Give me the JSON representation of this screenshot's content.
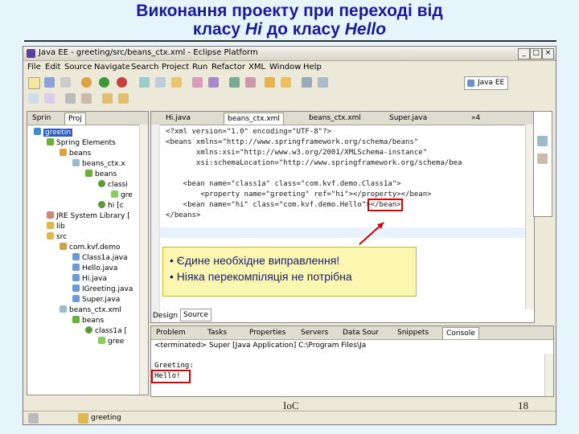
{
  "slide": {
    "title_line1": "Виконання проекту при переході від",
    "title_line2_a": "класу ",
    "title_line2_hi": "Hi",
    "title_line2_b": " до класу ",
    "title_line2_hello": "Hello",
    "footer_center": "IoC",
    "page_number": "18"
  },
  "window": {
    "title": "Java EE - greeting/src/beans_ctx.xml - Eclipse Platform",
    "minimize": "_",
    "maximize": "□",
    "close": "×"
  },
  "menu": [
    "File",
    "Edit",
    "Source",
    "Navigate",
    "Search",
    "Project",
    "Run",
    "Refactor",
    "XML",
    "Window",
    "Help"
  ],
  "perspective": "Java EE",
  "explorer": {
    "tabs": [
      "Sprin",
      "Proj"
    ],
    "rows": [
      {
        "label": "greetin",
        "highlight": true
      },
      {
        "label": "Spring Elements"
      },
      {
        "label": "beans"
      },
      {
        "label": "beans_ctx.x"
      },
      {
        "label": "beans"
      },
      {
        "label": "classi"
      },
      {
        "label": "gre"
      },
      {
        "label": "hi [c"
      },
      {
        "label": "JRE System Library ["
      },
      {
        "label": "lib"
      },
      {
        "label": "src"
      },
      {
        "label": "com.kvf.demo"
      },
      {
        "label": "Class1a.java"
      },
      {
        "label": "Hello.java"
      },
      {
        "label": "Hi.java"
      },
      {
        "label": "IGreeting.java"
      },
      {
        "label": "Super.java"
      },
      {
        "label": "beans_ctx.xml"
      },
      {
        "label": "beans"
      },
      {
        "label": "class1a ["
      },
      {
        "label": "gree"
      }
    ]
  },
  "editor": {
    "tabs": [
      "Hi.java",
      "beans_ctx.xml",
      "beans_ctx.xml",
      "Super.java",
      "»4"
    ],
    "lines": [
      "<?xml version=\"1.0\" encoding=\"UTF-8\"?>",
      "<beans xmlns=\"http://www.springframework.org/schema/beans\"",
      "       xmlns:xsi=\"http://www.w3.org/2001/XMLSchema-instance\"",
      "       xsi:schemaLocation=\"http://www.springframework.org/schema/bea",
      "",
      "    <bean name=\"class1a\" class=\"com.kvf.demo.Class1a\">",
      "        <property name=\"greeting\" ref=\"hi\"></property></bean>",
      "    <bean name=\"hi\" class=\"com.kvf.demo.Hello\"></bean>",
      "</beans>"
    ],
    "bottom_tabs": [
      "Design",
      "Source"
    ]
  },
  "callout": {
    "line1": "Єдине необхідне виправлення!",
    "line2": "Ніяка перекомпіляція не потрібна"
  },
  "console": {
    "tabs": [
      "Problem",
      "Tasks",
      "Properties",
      "Servers",
      "Data Sour",
      "Snippets",
      "Console"
    ],
    "header": "<terminated> Super [Java Application] C:\\Program Files\\Ja",
    "output": [
      "Greeting:",
      "Hello!"
    ]
  },
  "status": {
    "project": "greeting"
  },
  "colors": {
    "title": "#1a1a9a",
    "callout_bg": "#fcf7b0",
    "highlight_box": "#dd0000",
    "selection": "#2f5dc2"
  }
}
